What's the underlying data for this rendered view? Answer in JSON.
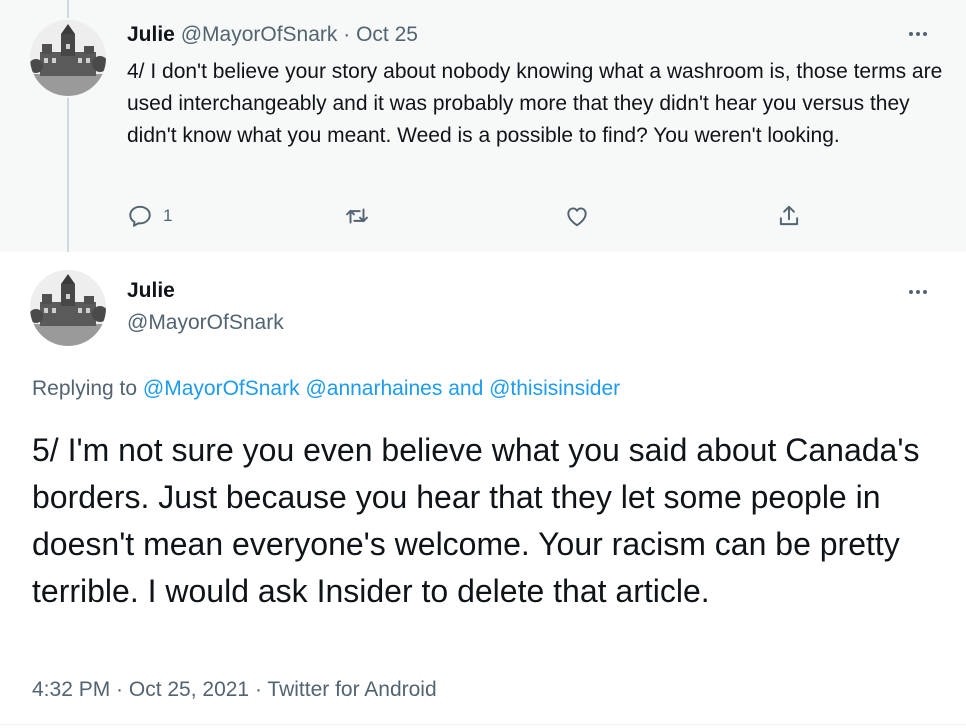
{
  "previous_tweet": {
    "display_name": "Julie",
    "handle": "@MayorOfSnark",
    "separator": " · ",
    "date": "Oct 25",
    "text": "4/ I don't believe your story about nobody knowing what a washroom is, those terms are used interchangeably and it was probably more that they didn't hear you versus they didn't know what you meant. Weed is a possible to find? You weren't looking.",
    "reply_count": "1",
    "icons": [
      "reply-icon",
      "retweet-icon",
      "like-icon",
      "share-icon",
      "more-icon"
    ]
  },
  "main_tweet": {
    "display_name": "Julie",
    "handle": "@MayorOfSnark",
    "replying_prefix": "Replying to ",
    "replying_user1": "@MayorOfSnark",
    "replying_user2": "@annarhaines",
    "replying_and": " and ",
    "replying_user3": "@thisisinsider",
    "text": "5/ I'm not sure you even believe what you said about Canada's borders. Just because you hear that they let some people in doesn't mean everyone's welcome. Your racism can be pretty terrible. I would ask Insider to delete that article.",
    "timestamp": "4:32 PM · Oct 25, 2021 · Twitter for Android"
  },
  "colors": {
    "link": "#1d9bf0",
    "secondary_text": "#536471",
    "primary_text": "#0f1419",
    "thread_background": "#f7f9f9",
    "thread_line": "#cfd9de"
  }
}
